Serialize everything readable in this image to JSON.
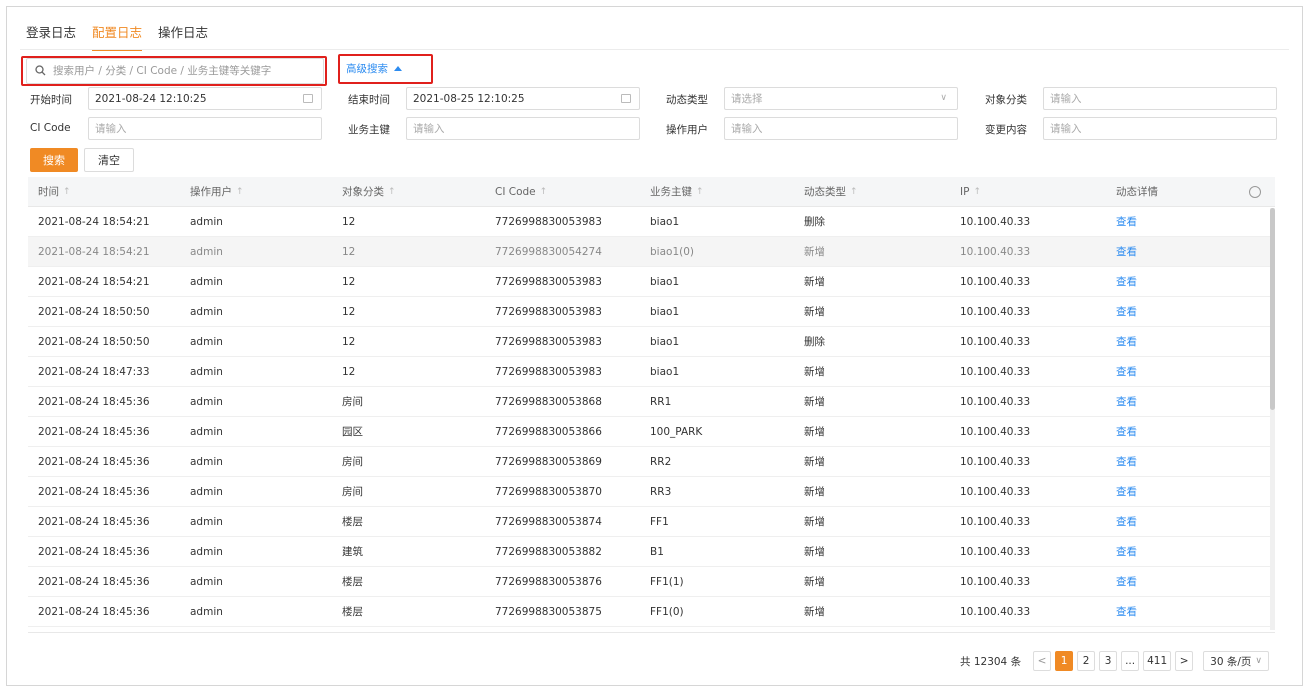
{
  "tabs": [
    {
      "label": "登录日志",
      "active": false
    },
    {
      "label": "配置日志",
      "active": true
    },
    {
      "label": "操作日志",
      "active": false
    }
  ],
  "search": {
    "placeholder": "搜索用户 / 分类 / CI Code / 业务主键等关键字",
    "advanced_label": "高级搜索"
  },
  "filters": {
    "start_time": {
      "label": "开始时间",
      "value": "2021-08-24 12:10:25"
    },
    "end_time": {
      "label": "结束时间",
      "value": "2021-08-25 12:10:25"
    },
    "dynamic_type": {
      "label": "动态类型",
      "placeholder": "请选择"
    },
    "object_category": {
      "label": "对象分类",
      "placeholder": "请输入"
    },
    "ci_code": {
      "label": "CI Code",
      "placeholder": "请输入"
    },
    "business_key": {
      "label": "业务主键",
      "placeholder": "请输入"
    },
    "operator": {
      "label": "操作用户",
      "placeholder": "请输入"
    },
    "change_content": {
      "label": "变更内容",
      "placeholder": "请输入"
    }
  },
  "buttons": {
    "search": "搜索",
    "clear": "清空"
  },
  "table": {
    "columns": [
      "时间",
      "操作用户",
      "对象分类",
      "CI Code",
      "业务主键",
      "动态类型",
      "IP",
      "动态详情"
    ],
    "rows": [
      [
        "2021-08-24 18:54:21",
        "admin",
        "12",
        "7726998830053983",
        "biao1",
        "删除",
        "10.100.40.33",
        "查看"
      ],
      [
        "2021-08-24 18:54:21",
        "admin",
        "12",
        "7726998830054274",
        "biao1(0)",
        "新增",
        "10.100.40.33",
        "查看"
      ],
      [
        "2021-08-24 18:54:21",
        "admin",
        "12",
        "7726998830053983",
        "biao1",
        "新增",
        "10.100.40.33",
        "查看"
      ],
      [
        "2021-08-24 18:50:50",
        "admin",
        "12",
        "7726998830053983",
        "biao1",
        "新增",
        "10.100.40.33",
        "查看"
      ],
      [
        "2021-08-24 18:50:50",
        "admin",
        "12",
        "7726998830053983",
        "biao1",
        "删除",
        "10.100.40.33",
        "查看"
      ],
      [
        "2021-08-24 18:47:33",
        "admin",
        "12",
        "7726998830053983",
        "biao1",
        "新增",
        "10.100.40.33",
        "查看"
      ],
      [
        "2021-08-24 18:45:36",
        "admin",
        "房间",
        "7726998830053868",
        "RR1",
        "新增",
        "10.100.40.33",
        "查看"
      ],
      [
        "2021-08-24 18:45:36",
        "admin",
        "园区",
        "7726998830053866",
        "100_PARK",
        "新增",
        "10.100.40.33",
        "查看"
      ],
      [
        "2021-08-24 18:45:36",
        "admin",
        "房间",
        "7726998830053869",
        "RR2",
        "新增",
        "10.100.40.33",
        "查看"
      ],
      [
        "2021-08-24 18:45:36",
        "admin",
        "房间",
        "7726998830053870",
        "RR3",
        "新增",
        "10.100.40.33",
        "查看"
      ],
      [
        "2021-08-24 18:45:36",
        "admin",
        "楼层",
        "7726998830053874",
        "FF1",
        "新增",
        "10.100.40.33",
        "查看"
      ],
      [
        "2021-08-24 18:45:36",
        "admin",
        "建筑",
        "7726998830053882",
        "B1",
        "新增",
        "10.100.40.33",
        "查看"
      ],
      [
        "2021-08-24 18:45:36",
        "admin",
        "楼层",
        "7726998830053876",
        "FF1(1)",
        "新增",
        "10.100.40.33",
        "查看"
      ],
      [
        "2021-08-24 18:45:36",
        "admin",
        "楼层",
        "7726998830053875",
        "FF1(0)",
        "新增",
        "10.100.40.33",
        "查看"
      ]
    ],
    "highlighted_row": 1
  },
  "pagination": {
    "total": "共 12304 条",
    "pages": [
      "1",
      "2",
      "3",
      "...",
      "411"
    ],
    "current": "1",
    "page_size": "30 条/页"
  },
  "colors": {
    "accent": "#f08a24",
    "link": "#2d8cf0",
    "annotation": "#e0201c"
  }
}
